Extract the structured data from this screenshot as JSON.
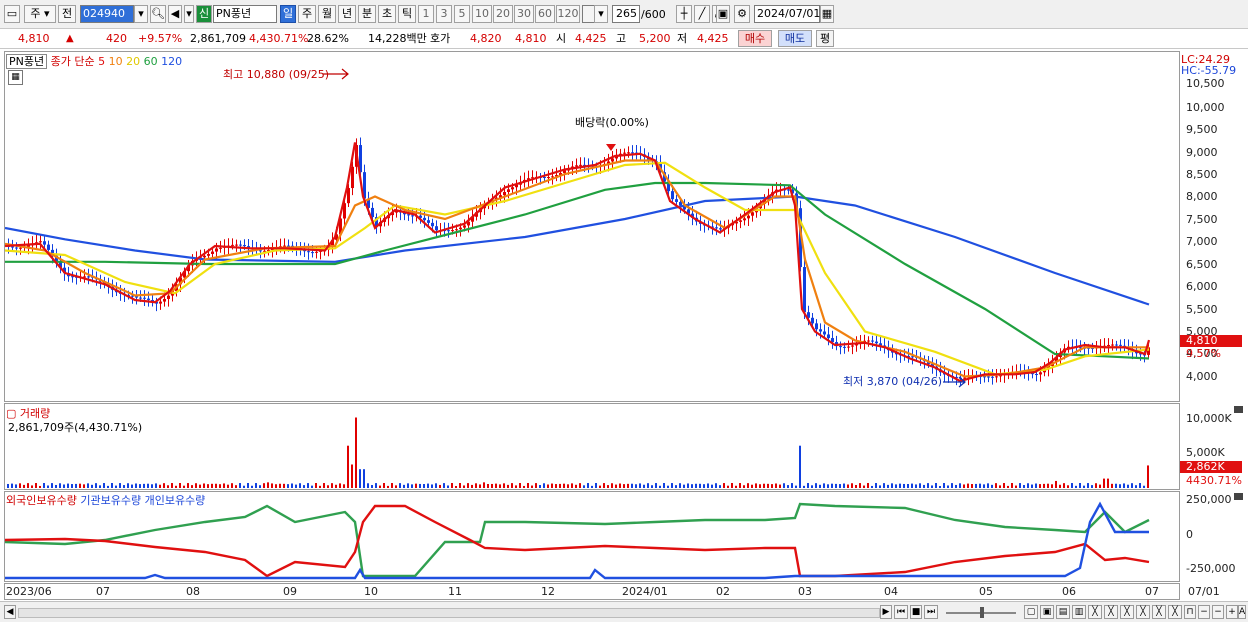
{
  "toolbar": {
    "market": "주",
    "prev_label": "전",
    "code": "024940",
    "badge_new": "신",
    "stock_name": "PN풍년",
    "periods": [
      "일",
      "주",
      "월",
      "년",
      "분",
      "초",
      "틱"
    ],
    "selected_period": "일",
    "intervals": [
      "1",
      "3",
      "5",
      "10",
      "20",
      "30",
      "60",
      "120"
    ],
    "count": "265",
    "count_total": "/600",
    "date": "2024/07/01"
  },
  "quote": {
    "price": "4,810",
    "up_arrow": "▲",
    "change": "420",
    "change_pct": "+9.57%",
    "volume": "2,861,709",
    "volume_pct": "4,430.71%",
    "turnover": "28.62%",
    "amount": "14,228백만",
    "ask_label": "호가",
    "ask1": "4,820",
    "ask2": "4,810",
    "open_label": "시",
    "open": "4,425",
    "high_label": "고",
    "high": "5,200",
    "low_label": "저",
    "low": "4,425",
    "buy_label": "매수",
    "sell_label": "매도",
    "eval_label": "평"
  },
  "price_panel": {
    "legend_name": "PN풍년",
    "legend_prefix": "종가 단순",
    "ma_labels": [
      "5",
      "10",
      "20",
      "60",
      "120"
    ],
    "lc": "LC:24.29",
    "hc": "HC:-55.79",
    "y_labels": [
      "10,500",
      "10,000",
      "9,500",
      "9,000",
      "8,500",
      "8,000",
      "7,500",
      "7,000",
      "6,500",
      "6,000",
      "5,500",
      "5,000",
      "4,500",
      "4,000"
    ],
    "current_tag": "4,810",
    "change_tag": "9.57%",
    "high_annotation": "최고 10,880 (09/25)",
    "low_annotation": "최저 3,870 (04/26)",
    "dividend_annotation": "배당락(0.00%)"
  },
  "volume_panel": {
    "title": "거래량",
    "value": "2,861,709주(4,430.71%)",
    "y_labels": [
      "10,000K",
      "5,000K"
    ],
    "current_tag": "2,862K",
    "pct_tag": "4430.71%"
  },
  "holding_panel": {
    "legends": [
      "외국인보유수량",
      "기관보유수량",
      "개인보유수량"
    ],
    "y_labels": [
      "250,000",
      "0",
      "-250,000"
    ]
  },
  "x_axis": {
    "labels": [
      "2023/06",
      "07",
      "08",
      "09",
      "10",
      "11",
      "12",
      "2024/01",
      "02",
      "03",
      "04",
      "05",
      "06",
      "07"
    ],
    "right_label": "07/01"
  },
  "colors": {
    "ma5": "#e01010",
    "ma10": "#f08010",
    "ma20": "#f0e010",
    "ma60": "#20a040",
    "ma120": "#2050e0",
    "up": "#e00000",
    "down": "#1040e0",
    "foreign": "#e01010",
    "institution": "#2050e0",
    "individual": "#30a050"
  },
  "chart_data": {
    "type": "candlestick",
    "x_range": [
      "2023/06",
      "2024/07/01"
    ],
    "y_range": [
      3800,
      10900
    ],
    "price_series": [
      {
        "date": "2023/06",
        "close": 6900
      },
      {
        "date": "2023/07",
        "close": 6100
      },
      {
        "date": "2023/07 late",
        "close": 5600
      },
      {
        "date": "2023/08",
        "close": 6500
      },
      {
        "date": "2023/09",
        "close": 6800
      },
      {
        "date": "2023/09/25",
        "close": 10880
      },
      {
        "date": "2023/10",
        "close": 7600
      },
      {
        "date": "2023/11",
        "close": 7600
      },
      {
        "date": "2023/12",
        "close": 8700
      },
      {
        "date": "2024/01",
        "close": 8900
      },
      {
        "date": "2024/02",
        "close": 7300
      },
      {
        "date": "2024/02 late",
        "close": 8200
      },
      {
        "date": "2024/03",
        "close": 5000
      },
      {
        "date": "2024/04",
        "close": 4600
      },
      {
        "date": "2024/04/26",
        "close": 3870
      },
      {
        "date": "2024/05",
        "close": 4050
      },
      {
        "date": "2024/06",
        "close": 4700
      },
      {
        "date": "2024/07/01",
        "close": 4810
      }
    ],
    "ma120_end": 5600,
    "ma60_end": 4400
  }
}
